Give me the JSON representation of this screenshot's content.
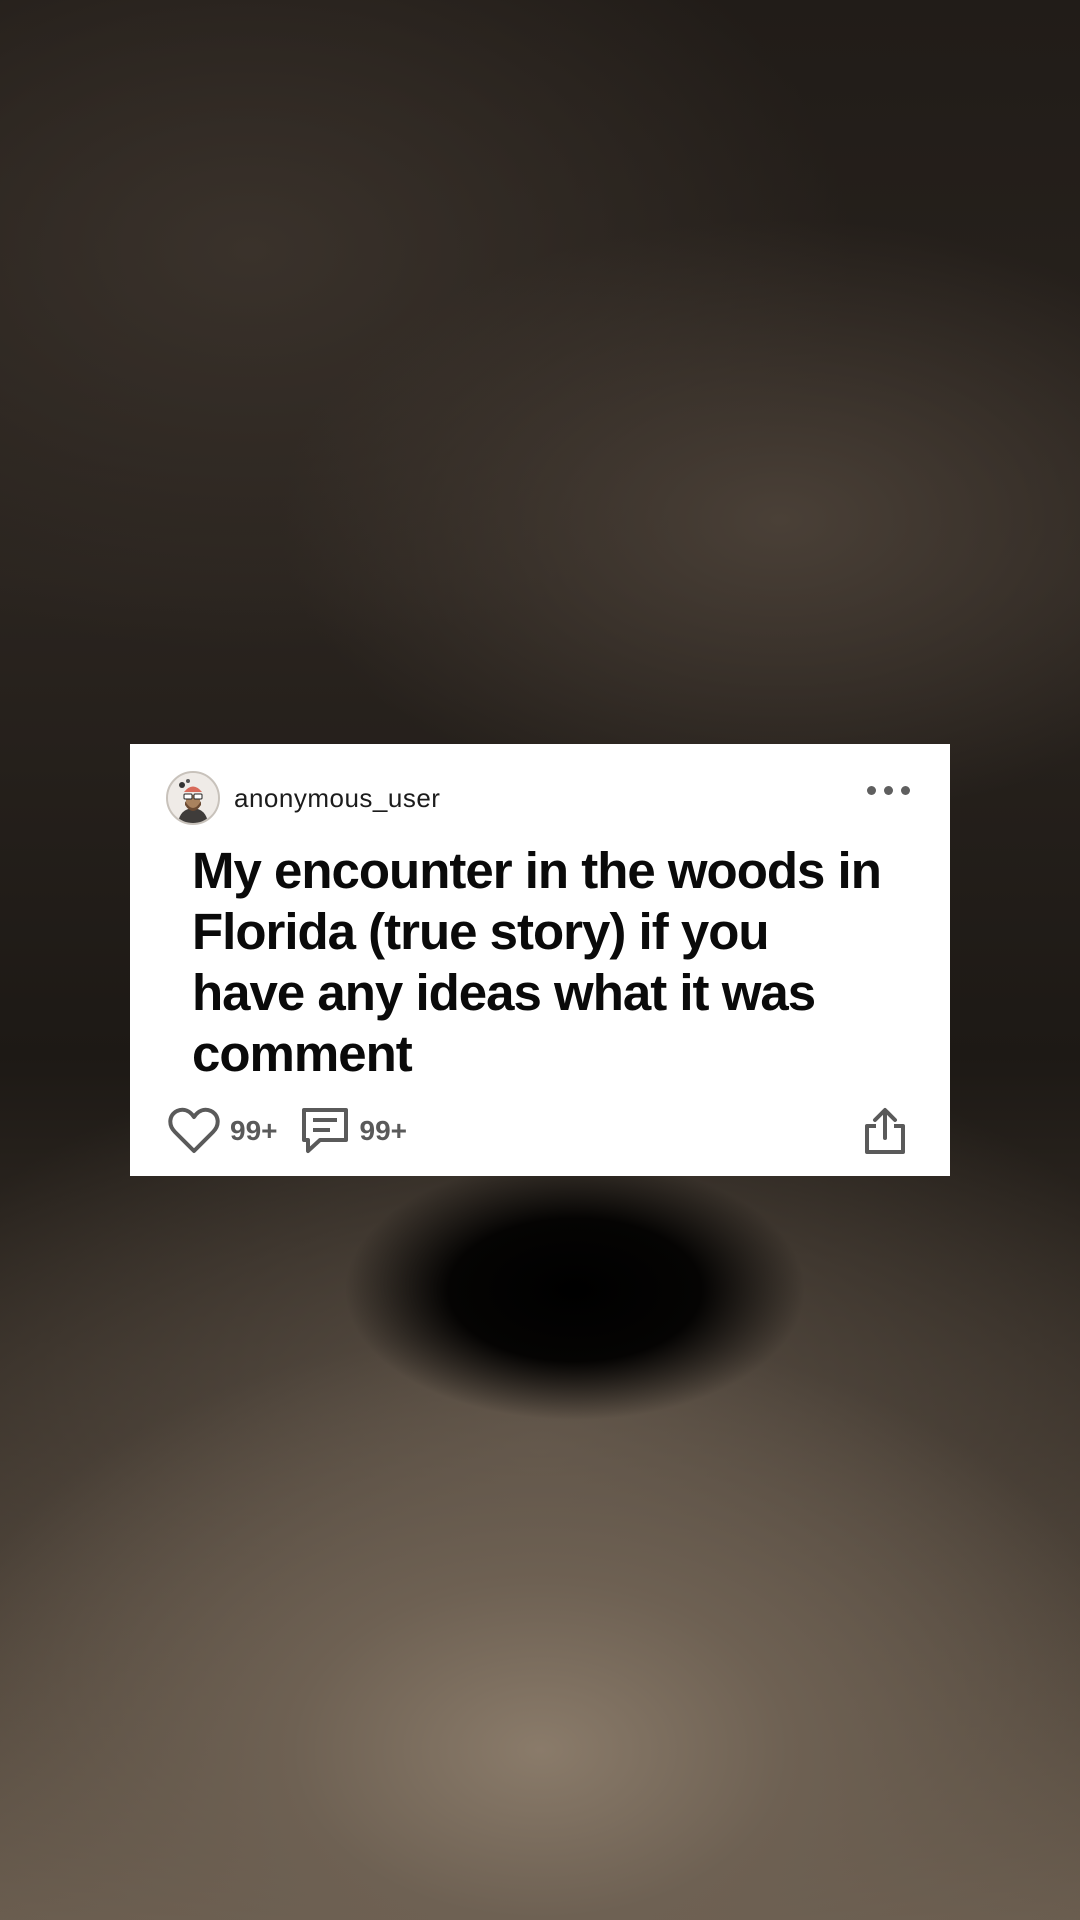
{
  "post": {
    "username": "anonymous_user",
    "title": "My encounter in the woods in Florida (true story) if you have any ideas what it was comment",
    "likes_count": "99+",
    "comments_count": "99+"
  },
  "icons": {
    "avatar": "avatar-icon",
    "more": "more-options-icon",
    "like": "heart-icon",
    "comment": "comment-icon",
    "share": "share-icon"
  },
  "colors": {
    "card_background": "#ffffff",
    "title_text": "#0a0a0a",
    "count_text": "#5a5a5a",
    "icon": "#5a5a5a"
  }
}
